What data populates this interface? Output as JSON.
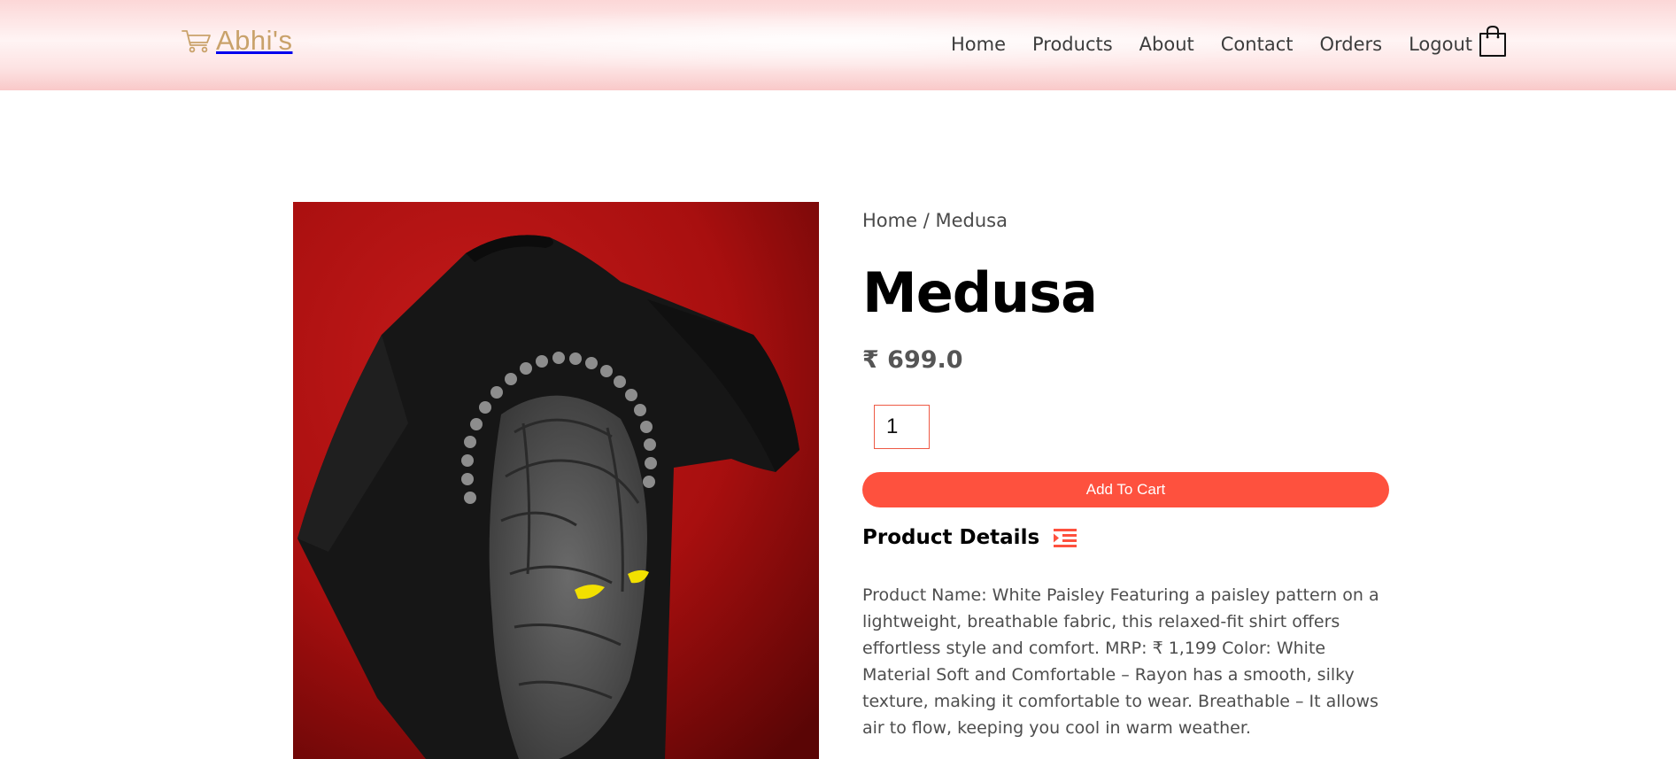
{
  "header": {
    "logo_text": "Abhi's",
    "nav": {
      "home": "Home",
      "products": "Products",
      "about": "About",
      "contact": "Contact",
      "orders": "Orders",
      "logout": "Logout"
    },
    "icons": {
      "logo": "shopping-cart-icon",
      "cart": "shopping-bag-icon"
    }
  },
  "breadcrumb": {
    "home": "Home",
    "separator": "/",
    "current": "Medusa"
  },
  "product": {
    "title": "Medusa",
    "price": "₹ 699.0",
    "quantity": "1",
    "add_to_cart_label": "Add To Cart",
    "details_heading": "Product Details",
    "details_icon": "indent-list-icon",
    "description": "Product Name: White Paisley Featuring a paisley pattern on a lightweight, breathable fabric, this relaxed-fit shirt offers effortless style and comfort. MRP: ₹ 1,199 Color: White Material Soft and Comfortable – Rayon has a smooth, silky texture, making it comfortable to wear. Breathable – It allows air to flow, keeping you cool in warm weather."
  },
  "colors": {
    "accent": "#fe513e",
    "logo_gold": "#c9a26b",
    "header_pink": "#fcd7d7",
    "image_background_red": "#b11414",
    "tshirt_black": "#151515",
    "eye_yellow": "#f2e000"
  }
}
